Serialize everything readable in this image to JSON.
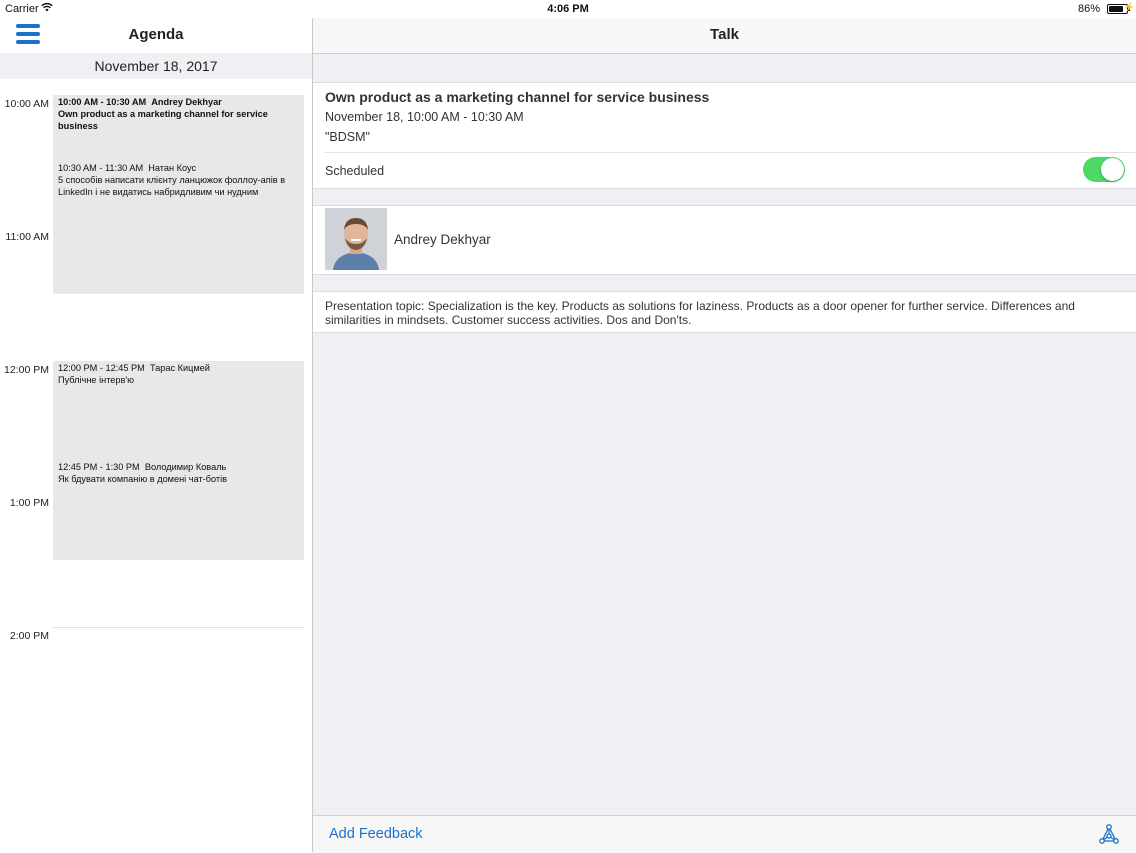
{
  "status_bar": {
    "carrier": "Carrier",
    "time": "4:06 PM",
    "battery": "86%"
  },
  "agenda": {
    "title": "Agenda",
    "date": "November 18, 2017",
    "hours": [
      "10:00 AM",
      "11:00 AM",
      "12:00 PM",
      "1:00 PM",
      "2:00 PM"
    ],
    "events": [
      {
        "time": "10:00 AM - 10:30 AM",
        "speaker": "Andrey Dekhyar",
        "title": "Own product as a marketing channel for service business"
      },
      {
        "time": "10:30 AM - 11:30 AM",
        "speaker": "Натан Коус",
        "title": "5 способів написати клієнту ланцюжок фоллоу-апів в LinkedIn і не видатись набридливим чи нудним"
      },
      {
        "time": "12:00 PM - 12:45 PM",
        "speaker": "Тарас Кицмей",
        "title": "Публічне інтерв'ю"
      },
      {
        "time": "12:45 PM - 1:30 PM",
        "speaker": "Володимир Коваль",
        "title": "Як бдувати компанію в домені чат-ботів"
      }
    ]
  },
  "talk": {
    "nav_title": "Talk",
    "title": "Own product as a marketing channel for service business",
    "time": "November 18, 10:00 AM - 10:30 AM",
    "room": "\"BDSM\"",
    "scheduled_label": "Scheduled",
    "scheduled": true,
    "speaker_name": "Andrey Dekhyar",
    "description": "Presentation topic: Specialization is the key. Products as solutions for laziness. Products as a door opener for further service. Differences and similarities in mindsets. Customer success activities. Dos and Don'ts.",
    "add_feedback": "Add Feedback"
  },
  "icons": {
    "menu": "hamburger-menu-icon",
    "share": "share-nodes-icon",
    "wifi": "wifi-icon",
    "battery": "battery-icon"
  },
  "colors": {
    "accent": "#1a73c7",
    "toggle_on": "#4cd964",
    "event_block": "#e8e8e8",
    "grouped_bg": "#efeff4"
  }
}
